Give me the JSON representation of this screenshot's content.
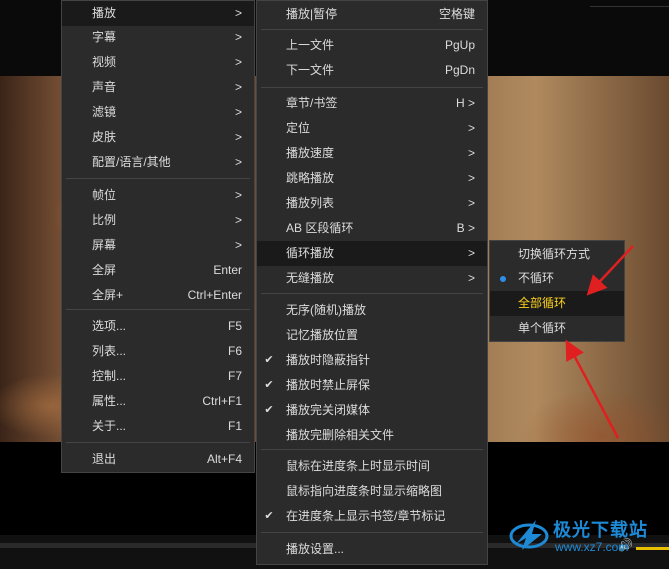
{
  "main_menu": [
    {
      "label": "播放",
      "shortcut": ">",
      "highlight": true
    },
    {
      "label": "字幕",
      "shortcut": ">"
    },
    {
      "label": "视频",
      "shortcut": ">"
    },
    {
      "label": "声音",
      "shortcut": ">"
    },
    {
      "label": "滤镜",
      "shortcut": ">"
    },
    {
      "label": "皮肤",
      "shortcut": ">"
    },
    {
      "label": "配置/语言/其他",
      "shortcut": ">"
    },
    {
      "label": "帧位",
      "shortcut": ">"
    },
    {
      "label": "比例",
      "shortcut": ">"
    },
    {
      "label": "屏幕",
      "shortcut": ">"
    },
    {
      "label": "全屏",
      "shortcut": "Enter"
    },
    {
      "label": "全屏+",
      "shortcut": "Ctrl+Enter"
    },
    {
      "label": "选项...",
      "shortcut": "F5"
    },
    {
      "label": "列表...",
      "shortcut": "F6"
    },
    {
      "label": "控制...",
      "shortcut": "F7"
    },
    {
      "label": "属性...",
      "shortcut": "Ctrl+F1"
    },
    {
      "label": "关于...",
      "shortcut": "F1"
    },
    {
      "label": "退出",
      "shortcut": "Alt+F4"
    }
  ],
  "play_menu": [
    {
      "label": "播放|暂停",
      "shortcut": "空格键"
    },
    {
      "label": "上一文件",
      "shortcut": "PgUp"
    },
    {
      "label": "下一文件",
      "shortcut": "PgDn"
    },
    {
      "label": "章节/书签",
      "shortcut": "H >"
    },
    {
      "label": "定位",
      "shortcut": ">"
    },
    {
      "label": "播放速度",
      "shortcut": ">"
    },
    {
      "label": "跳略播放",
      "shortcut": ">"
    },
    {
      "label": "播放列表",
      "shortcut": ">"
    },
    {
      "label": "AB 区段循环",
      "shortcut": "B >"
    },
    {
      "label": "循环播放",
      "shortcut": ">",
      "highlight": true
    },
    {
      "label": "无缝播放",
      "shortcut": ">"
    },
    {
      "label": "无序(随机)播放",
      "shortcut": ""
    },
    {
      "label": "记忆播放位置",
      "shortcut": ""
    },
    {
      "label": "播放时隐蔽指针",
      "shortcut": "",
      "checked": true
    },
    {
      "label": "播放时禁止屏保",
      "shortcut": "",
      "checked": true
    },
    {
      "label": "播放完关闭媒体",
      "shortcut": "",
      "checked": true
    },
    {
      "label": "播放完删除相关文件",
      "shortcut": ""
    },
    {
      "label": "鼠标在进度条上时显示时间",
      "shortcut": ""
    },
    {
      "label": "鼠标指向进度条时显示缩略图",
      "shortcut": ""
    },
    {
      "label": "在进度条上显示书签/章节标记",
      "shortcut": "",
      "checked": true
    },
    {
      "label": "播放设置...",
      "shortcut": ""
    }
  ],
  "loop_menu": [
    {
      "label": "切换循环方式"
    },
    {
      "label": "不循环",
      "selected": true
    },
    {
      "label": "全部循环",
      "highlight": true
    },
    {
      "label": "单个循环"
    }
  ],
  "watermark": {
    "title": "极光下载站",
    "url": "www.xz7.com"
  },
  "colors": {
    "menu_bg": "#2b2b2b",
    "highlight_bg": "#1a1a1a",
    "accent_yellow": "#ffd21c",
    "radio_blue": "#2f8ee8",
    "arrow_red": "#e02020"
  }
}
